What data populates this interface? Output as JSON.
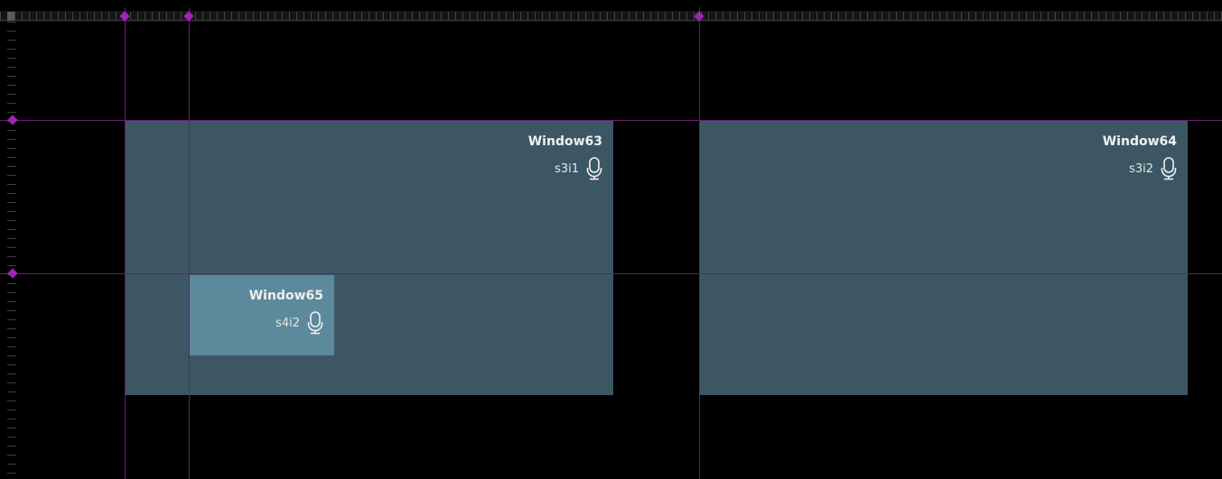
{
  "colors": {
    "background": "#000000",
    "window": "#3c5763",
    "window_selected": "#5c899b",
    "guide": "#6e1a7a",
    "guide_marker": "#a024b4",
    "text": "#f0f0f0"
  },
  "windows": [
    {
      "title": "Window63",
      "source": "s3i1",
      "icon": "microphone-icon"
    },
    {
      "title": "Window64",
      "source": "s3i2",
      "icon": "microphone-icon"
    },
    {
      "title": "Window65",
      "source": "s4i2",
      "icon": "microphone-icon"
    }
  ]
}
